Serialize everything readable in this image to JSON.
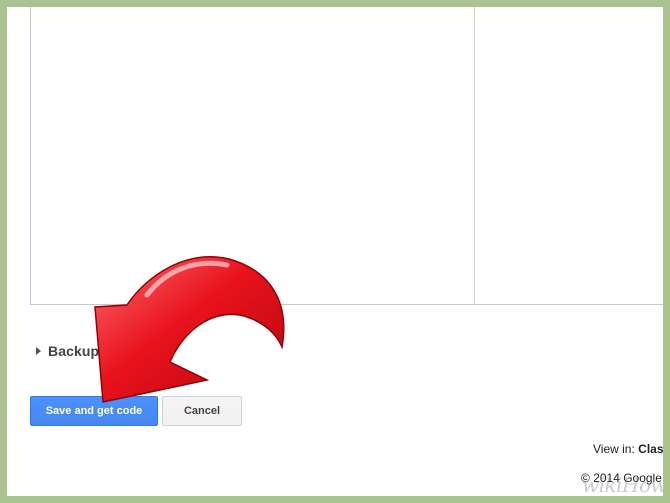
{
  "backup": {
    "label": "Backup",
    "icon": "triangle-right-icon"
  },
  "actions": {
    "save_label": "Save and get code",
    "cancel_label": "Cancel"
  },
  "footer": {
    "view_in_prefix": "View in:",
    "view_in_value": "Clas",
    "copyright": "© 2014 Google"
  },
  "watermark": {
    "brand": "wiki",
    "brand_suffix": "How"
  },
  "colors": {
    "page_border": "#a9c48f",
    "primary_button": "#4d90fe",
    "arrow": "#e8121c"
  }
}
